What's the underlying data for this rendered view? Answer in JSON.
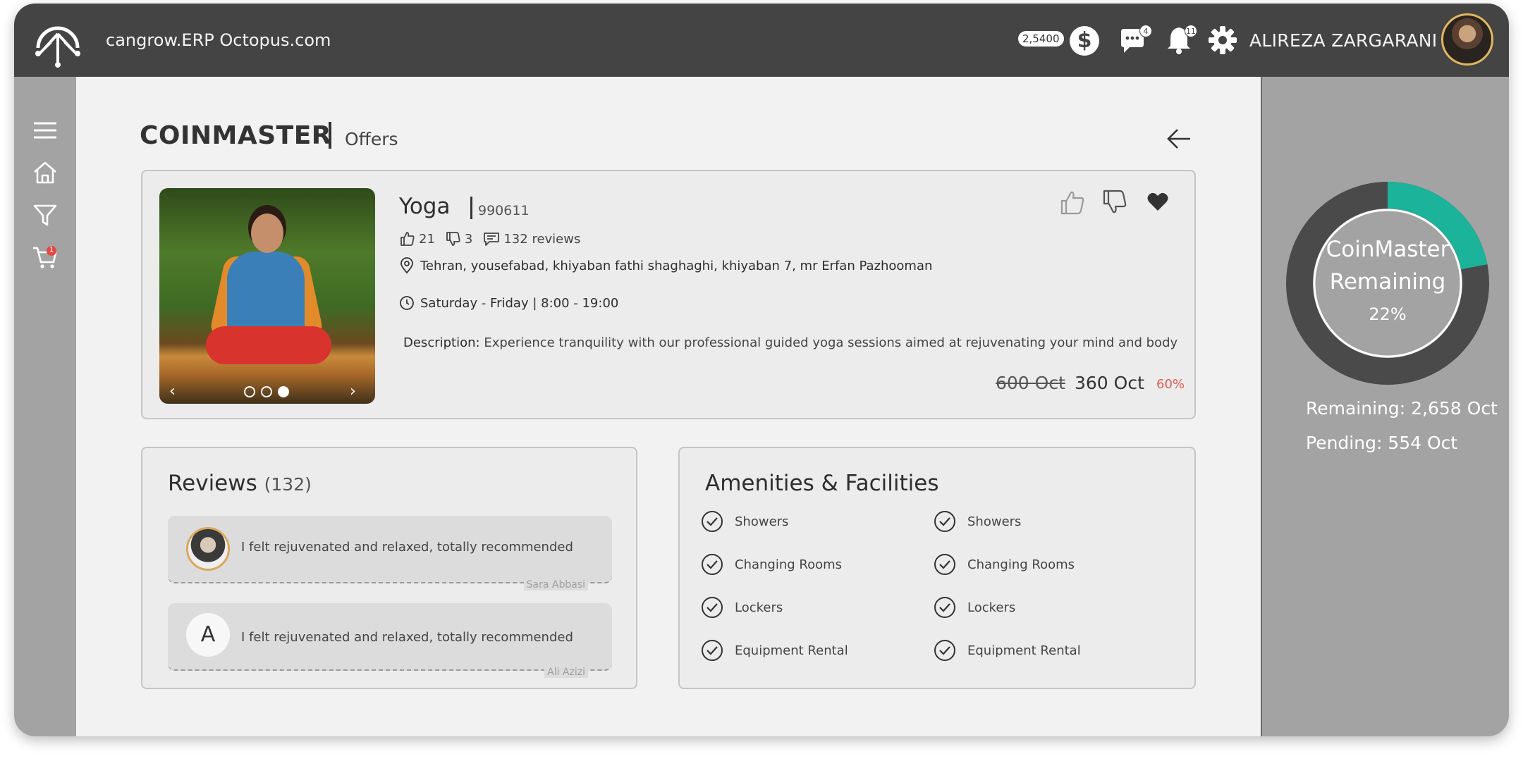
{
  "header": {
    "site_name": "cangrow.ERP Octopus.com",
    "balance": "2,5400",
    "currency_symbol": "$",
    "messages_count": "4",
    "notifications_count": "11",
    "user_name": "ALIREZA ZARGARANI"
  },
  "sidebar": {
    "cart_count": "1"
  },
  "page": {
    "title": "COINMASTER",
    "subtitle": "Offers"
  },
  "offer": {
    "name": "Yoga",
    "code": "990611",
    "likes": "21",
    "dislikes": "3",
    "reviews": "132 reviews",
    "address": "Tehran, yousefabad, khiyaban fathi shaghaghi, khiyaban 7, mr Erfan Pazhooman",
    "hours": "Saturday - Friday | 8:00 - 19:00",
    "description_label": "Description:",
    "description": "Experience tranquility with our professional guided yoga sessions aimed at rejuvenating your mind and body",
    "old_price": "600 Oct",
    "new_price": "360 Oct",
    "discount": "60%",
    "carousel": {
      "count": 3,
      "active": 3
    }
  },
  "reviews": {
    "title": "Reviews",
    "count": "(132)",
    "items": [
      {
        "text": "I felt rejuvenated and relaxed, totally recommended",
        "author": "Sara Abbasi"
      },
      {
        "initial": "A",
        "text": "I felt rejuvenated and relaxed, totally recommended",
        "author": "Ali Azizi"
      }
    ]
  },
  "amenities": {
    "title": "Amenities & Facilities",
    "items": [
      "Showers",
      "Changing Rooms",
      "Lockers",
      "Equipment Rental",
      "Showers",
      "Changing Rooms",
      "Lockers",
      "Equipment Rental"
    ]
  },
  "coinmaster": {
    "title_line1": "CoinMaster",
    "title_line2": "Remaining",
    "percent": "22%",
    "remaining_fraction": 0.22,
    "remaining": "Remaining: 2,658 Oct",
    "pending": "Pending: 554 Oct",
    "colors": {
      "accent": "#1bb39a",
      "track": "#4a4a4a",
      "inner": "#a3a3a3"
    }
  }
}
